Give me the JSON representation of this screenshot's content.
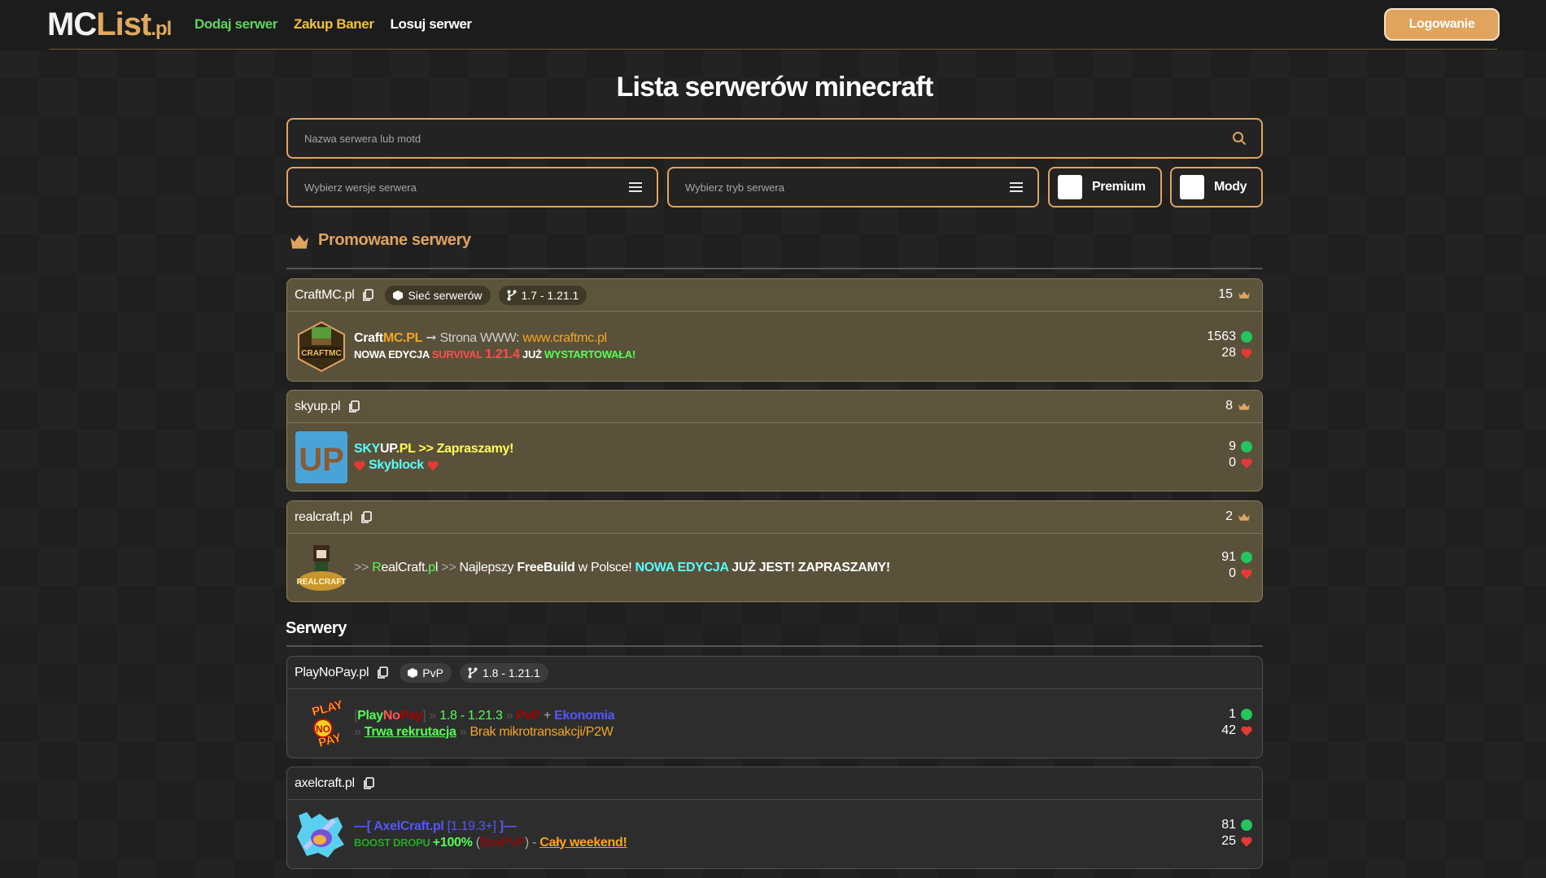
{
  "header": {
    "logo": {
      "mc": "MC",
      "list": "List",
      "pl": ".pl"
    },
    "nav": [
      "Dodaj serwer",
      "Zakup Baner",
      "Losuj serwer"
    ],
    "login_label": "Logowanie"
  },
  "main": {
    "title": "Lista serwerów minecraft",
    "search_placeholder": "Nazwa serwera lub motd",
    "version_placeholder": "Wybierz wersje serwera",
    "mode_placeholder": "Wybierz tryb serwera",
    "toggle_premium": "Premium",
    "toggle_mods": "Mody",
    "promoted_heading": "Promowane serwery",
    "servers_heading": "Serwery"
  },
  "promoted": [
    {
      "name": "CraftMC.pl",
      "tag_type": "Sieć serwerów",
      "tag_version": "1.7 - 1.21.1",
      "votes": "15",
      "online": "1563",
      "likes": "28",
      "motd": {
        "l1_a": "Craft",
        "l1_b": "MC.PL",
        "l1_c": " ➞ Strona WWW: ",
        "l1_d": "www.craftmc.pl",
        "l2_a": "NOWA EDYCJA ",
        "l2_b": "SURVIVAL ",
        "l2_c": "1.21.4",
        "l2_d": " JUŻ ",
        "l2_e": "WYSTARTOWAŁA",
        "l2_f": "!"
      }
    },
    {
      "name": "skyup.pl",
      "votes": "8",
      "online": "9",
      "likes": "0",
      "motd": {
        "l1_a": "SKY",
        "l1_b": "UP",
        "l1_c": ".PL",
        "l1_d": " >> Zapraszamy!",
        "l2_a": "Skyblock"
      }
    },
    {
      "name": "realcraft.pl",
      "votes": "2",
      "online": "91",
      "likes": "0",
      "motd": {
        "a": ">> ",
        "b": "R",
        "c": "ealCraft.",
        "d": "p",
        "e": "l",
        "f": " >> ",
        "g": "Najlepszy ",
        "h": "FreeBuild",
        "i": " w Polsce! ",
        "j": "NOWA EDYCJA",
        "k": " JUŻ JEST! ZAPRASZAMY!"
      }
    }
  ],
  "servers": [
    {
      "name": "PlayNoPay.pl",
      "tag_type": "PvP",
      "tag_version": "1.8 - 1.21.1",
      "online": "1",
      "likes": "42",
      "motd": {
        "l1_a": "[",
        "l1_b": "Play",
        "l1_c": "No",
        "l1_d": "Pay",
        "l1_e": "] » ",
        "l1_f": "1.8 - 1.21.3",
        "l1_g": " » ",
        "l1_h": "PvP",
        "l1_i": " + ",
        "l1_j": "Ekonomia",
        "l2_a": "» ",
        "l2_b": "Trwa rekrutacja",
        "l2_c": " » ",
        "l2_d": "Brak mikrotransakcji/P2W"
      },
      "avatar_text": [
        "PLAY",
        "NO",
        "PAY"
      ]
    },
    {
      "name": "axelcraft.pl",
      "online": "81",
      "likes": "25",
      "motd": {
        "l1_a": "—[ ",
        "l1_b": "AxelCraft.pl",
        "l1_c": " [1.19.3+]",
        "l1_d": " ]—",
        "l2_a": "BOOST DROPU ",
        "l2_b": "+100%",
        "l2_c": " (",
        "l2_d": "BoxPvP",
        "l2_e": ")",
        "l2_f": " - ",
        "l2_g": "Cały weekend!"
      }
    }
  ],
  "colors": {
    "accent": "#e0a45e",
    "online": "#22c55e",
    "heart": "#e53935",
    "promoted_bg": "#5a513a"
  }
}
